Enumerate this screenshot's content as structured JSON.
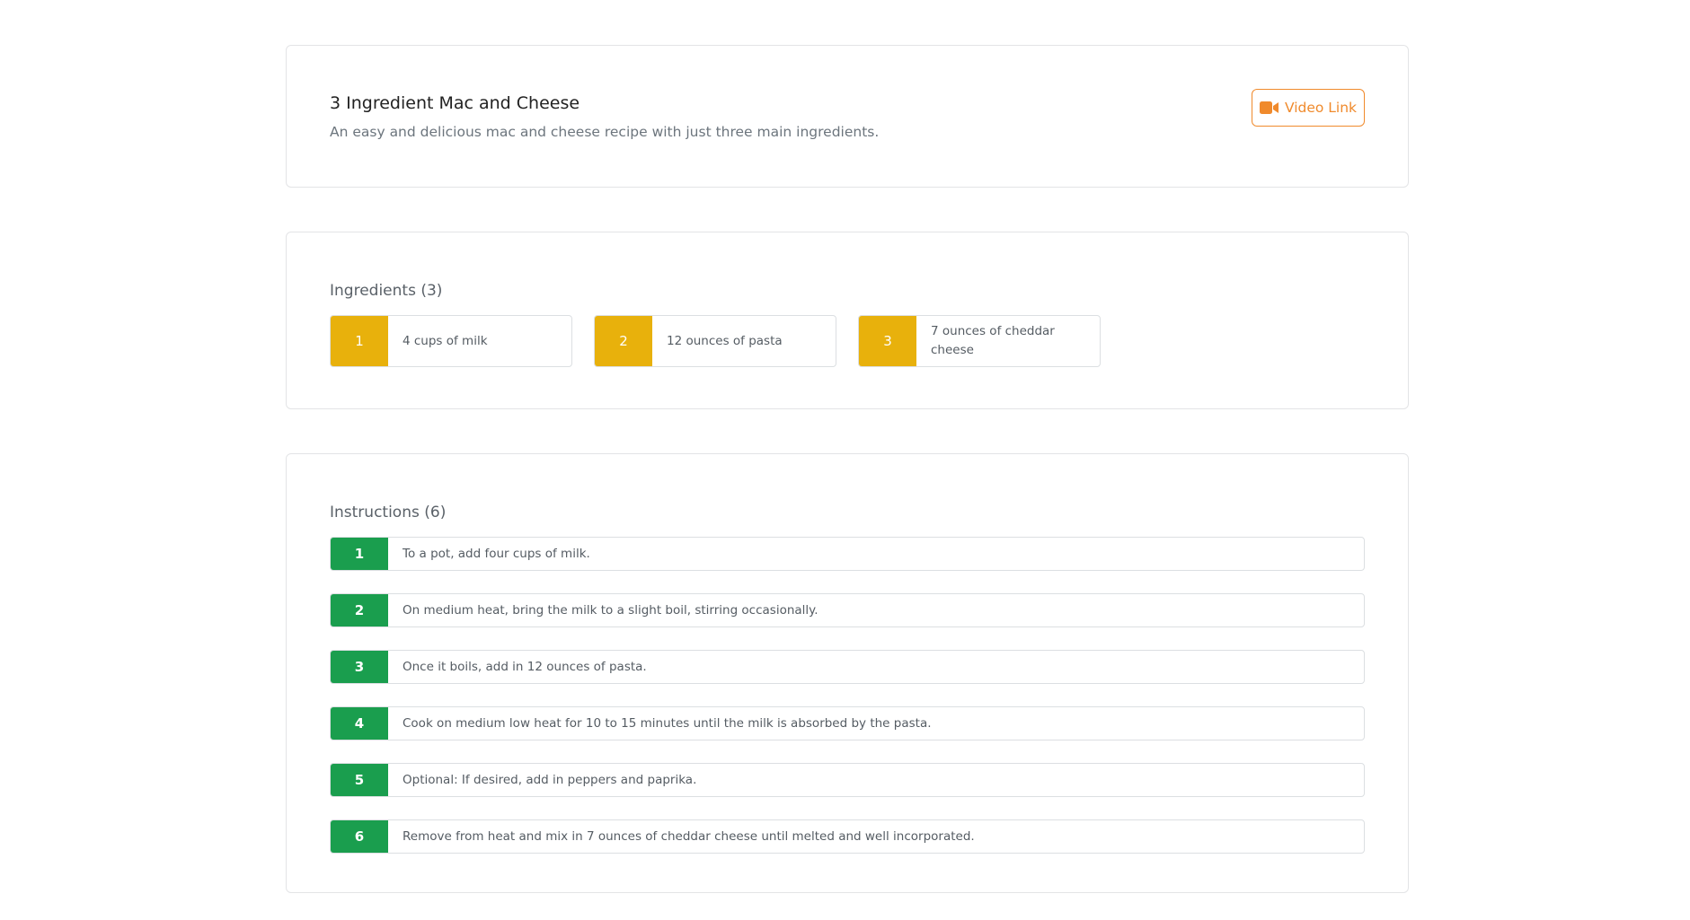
{
  "recipe": {
    "title": "3 Ingredient Mac and Cheese",
    "description": "An easy and delicious mac and cheese recipe with just three main ingredients.",
    "video_button": {
      "label": "Video Link",
      "icon": "video-camera-icon",
      "color": "#f08a2c"
    }
  },
  "ingredients": {
    "heading": "Ingredients (3)",
    "badge_color": "#e8b10c",
    "items": [
      {
        "number": "1",
        "text": "4 cups of milk"
      },
      {
        "number": "2",
        "text": "12 ounces of pasta"
      },
      {
        "number": "3",
        "text": "7 ounces of cheddar cheese"
      }
    ]
  },
  "instructions": {
    "heading": "Instructions (6)",
    "badge_color": "#1a9e4e",
    "steps": [
      {
        "number": "1",
        "text": "To a pot, add four cups of milk."
      },
      {
        "number": "2",
        "text": "On medium heat, bring the milk to a slight boil, stirring occasionally."
      },
      {
        "number": "3",
        "text": "Once it boils, add in 12 ounces of pasta."
      },
      {
        "number": "4",
        "text": "Cook on medium low heat for 10 to 15 minutes until the milk is absorbed by the pasta."
      },
      {
        "number": "5",
        "text": "Optional: If desired, add in peppers and paprika."
      },
      {
        "number": "6",
        "text": "Remove from heat and mix in 7 ounces of cheddar cheese until melted and well incorporated."
      }
    ]
  }
}
